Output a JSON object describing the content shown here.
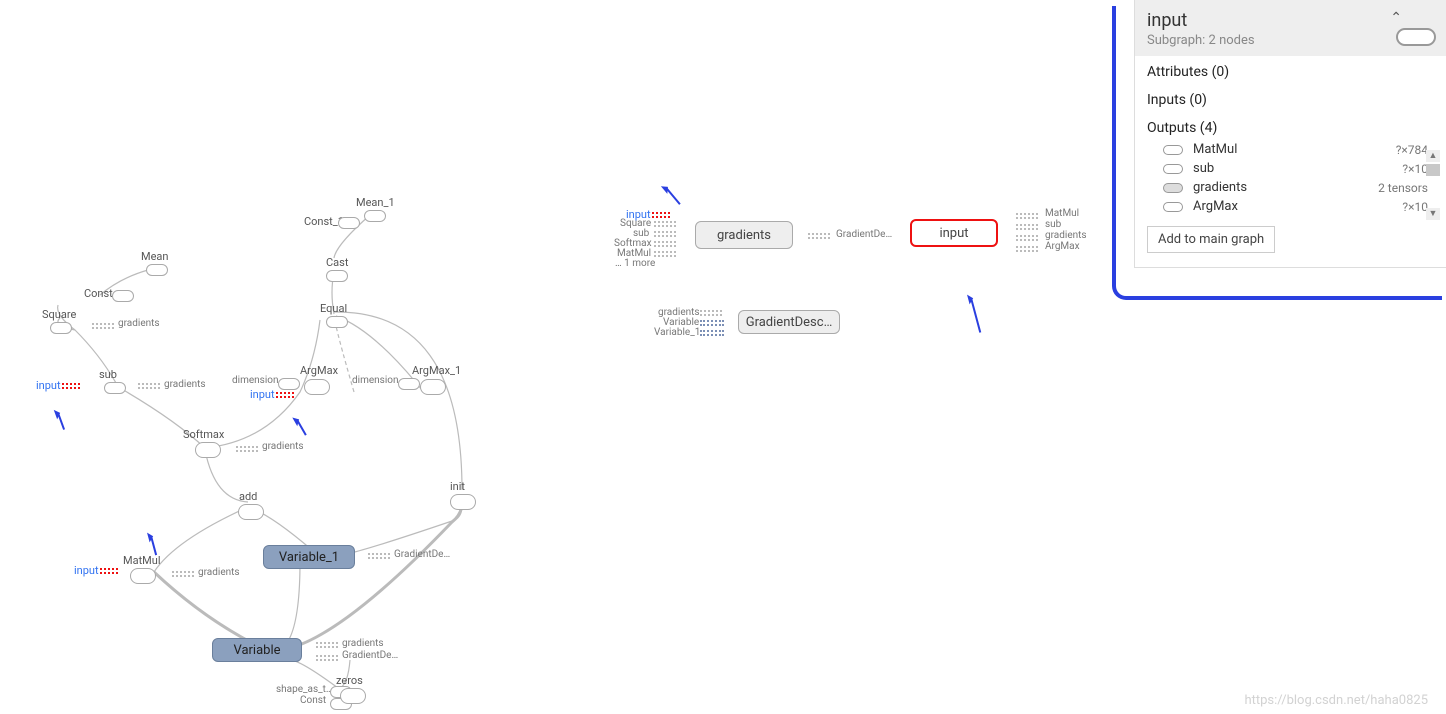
{
  "panel": {
    "title": "input",
    "subgraph": "Subgraph: 2 nodes",
    "attributes_hdr": "Attributes (0)",
    "inputs_hdr": "Inputs (0)",
    "outputs_hdr": "Outputs (4)",
    "outputs": [
      {
        "name": "MatMul",
        "shape": "?×784"
      },
      {
        "name": "sub",
        "shape": "?×10"
      },
      {
        "name": "gradients",
        "shape": "2 tensors"
      },
      {
        "name": "ArgMax",
        "shape": "?×10"
      }
    ],
    "add_btn": "Add to main graph"
  },
  "graph_left": {
    "ops": {
      "const": "Const",
      "mean": "Mean",
      "const1": "Const_1",
      "mean1": "Mean_1",
      "cast": "Cast",
      "equal": "Equal",
      "square": "Square",
      "sub": "sub",
      "argmax": "ArgMax",
      "argmax1": "ArgMax_1",
      "softmax": "Softmax",
      "add": "add",
      "init": "init",
      "matmul": "MatMul",
      "zeros": "zeros",
      "dimension": "dimension",
      "shape_as_t": "shape_as_t…",
      "const2": "Const"
    },
    "vars": {
      "variable": "Variable",
      "variable1": "Variable_1"
    },
    "aux": {
      "input": "input",
      "gradients": "gradients",
      "gradientde": "GradientDe…"
    }
  },
  "graph_right": {
    "gradients_box": "gradients",
    "gradientdesc_box": "GradientDesc…",
    "input_big": "input",
    "grad_inputs": [
      "input",
      "Square",
      "sub",
      "Softmax",
      "MatMul",
      "… 1 more"
    ],
    "grad_out": "GradientDe…",
    "gd_inputs": [
      "gradients",
      "Variable",
      "Variable_1"
    ],
    "input_outs": [
      "MatMul",
      "sub",
      "gradients",
      "ArgMax"
    ]
  },
  "watermark": "https://blog.csdn.net/haha0825"
}
